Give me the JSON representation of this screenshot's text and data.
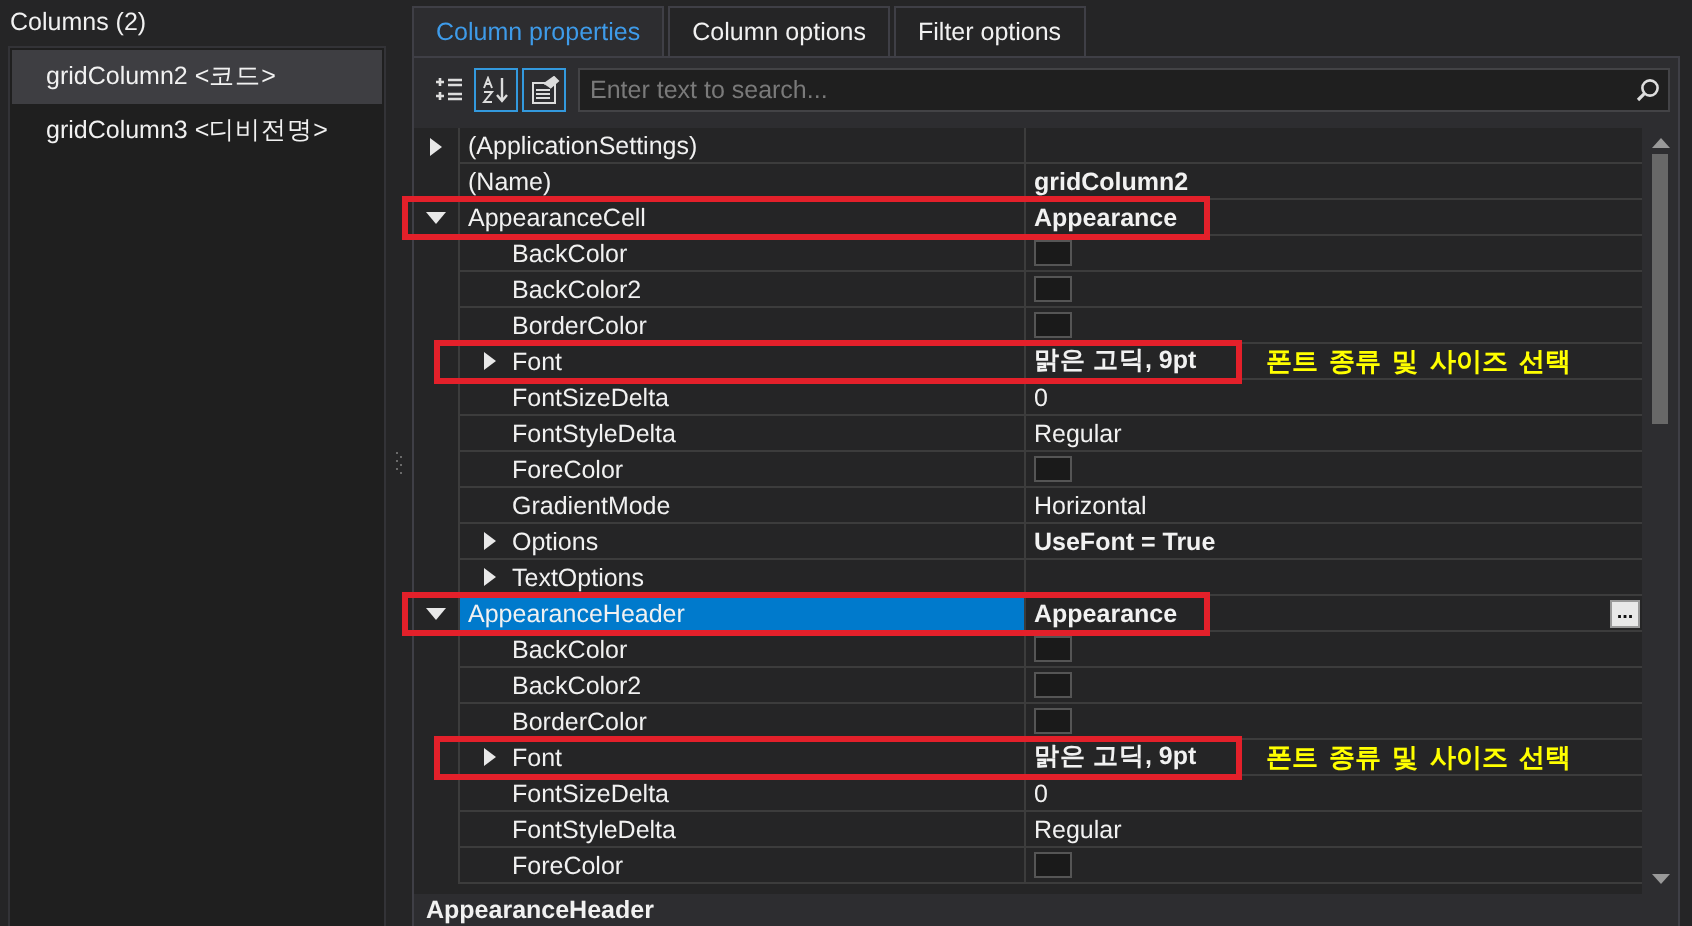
{
  "columns_panel": {
    "title": "Columns (2)",
    "items": [
      {
        "label": "gridColumn2 <코드>",
        "selected": true
      },
      {
        "label": "gridColumn3 <디비전명>",
        "selected": false
      }
    ]
  },
  "tabs": [
    {
      "label": "Column properties",
      "selected": true
    },
    {
      "label": "Column options",
      "selected": false
    },
    {
      "label": "Filter options",
      "selected": false
    }
  ],
  "toolbar": {
    "buttons": [
      {
        "kind": "categorized",
        "selected": false
      },
      {
        "kind": "alphabetical",
        "selected": true
      },
      {
        "kind": "property_pages",
        "selected": true
      }
    ],
    "search": {
      "placeholder": "Enter text to search..."
    }
  },
  "properties": [
    {
      "name": "(ApplicationSettings)",
      "kind": "text",
      "expanded": false,
      "selected": false
    },
    {
      "name": "(Name)",
      "kind": "text",
      "value": "gridColumn2",
      "modified": true,
      "selected": false
    },
    {
      "name": "AppearanceCell",
      "kind": "text",
      "value": "Appearance",
      "modified": true,
      "expanded": true,
      "selected": false,
      "highlighted": true,
      "children": [
        {
          "name": "BackColor",
          "kind": "color",
          "selected": false
        },
        {
          "name": "BackColor2",
          "kind": "color",
          "selected": false
        },
        {
          "name": "BorderColor",
          "kind": "color",
          "selected": false
        },
        {
          "name": "Font",
          "kind": "text",
          "value": "맑은 고딕, 9pt",
          "modified": true,
          "expanded": false,
          "selected": false,
          "highlighted": true,
          "callout": "폰트 종류 및 사이즈 선택"
        },
        {
          "name": "FontSizeDelta",
          "kind": "text",
          "value": "0",
          "modified": false,
          "selected": false
        },
        {
          "name": "FontStyleDelta",
          "kind": "text",
          "value": "Regular",
          "modified": false,
          "selected": false
        },
        {
          "name": "ForeColor",
          "kind": "color",
          "selected": false
        },
        {
          "name": "GradientMode",
          "kind": "text",
          "value": "Horizontal",
          "modified": false,
          "selected": false
        },
        {
          "name": "Options",
          "kind": "text",
          "value": "UseFont = True",
          "modified": true,
          "expanded": false,
          "selected": false
        },
        {
          "name": "TextOptions",
          "kind": "text",
          "expanded": false,
          "selected": false
        }
      ]
    },
    {
      "name": "AppearanceHeader",
      "kind": "text",
      "value": "Appearance",
      "modified": true,
      "expanded": true,
      "selected": true,
      "highlighted": true,
      "button": "...",
      "children": [
        {
          "name": "BackColor",
          "kind": "color",
          "selected": false
        },
        {
          "name": "BackColor2",
          "kind": "color",
          "selected": false
        },
        {
          "name": "BorderColor",
          "kind": "color",
          "selected": false
        },
        {
          "name": "Font",
          "kind": "text",
          "value": "맑은 고딕, 9pt",
          "modified": true,
          "expanded": false,
          "selected": false,
          "highlighted": true,
          "callout": "폰트 종류 및 사이즈 선택"
        },
        {
          "name": "FontSizeDelta",
          "kind": "text",
          "value": "0",
          "modified": false,
          "selected": false
        },
        {
          "name": "FontStyleDelta",
          "kind": "text",
          "value": "Regular",
          "modified": false,
          "selected": false
        },
        {
          "name": "ForeColor",
          "kind": "color",
          "selected": false
        }
      ]
    }
  ],
  "description": {
    "title": "AppearanceHeader"
  }
}
